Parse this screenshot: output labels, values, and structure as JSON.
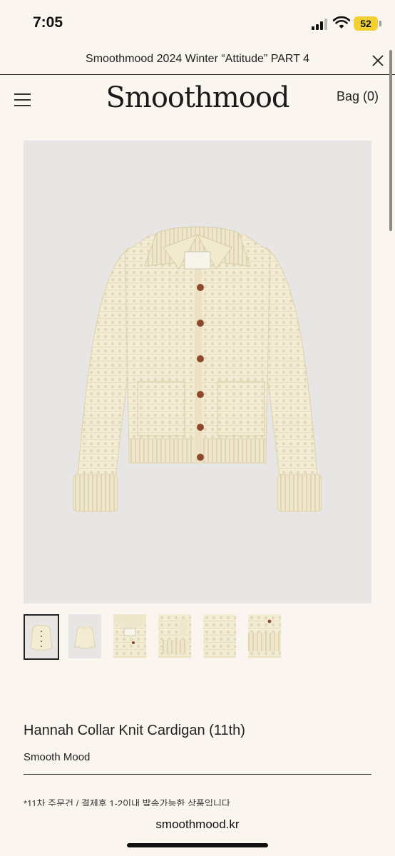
{
  "status_bar": {
    "time": "7:05",
    "battery": "52",
    "icons": [
      "signal-icon",
      "wifi-icon",
      "battery-icon"
    ]
  },
  "banner": {
    "text": "Smoothmood 2024 Winter “Attitude” PART 4",
    "close_icon": "close-icon"
  },
  "header": {
    "menu_icon": "hamburger-menu-icon",
    "logo": "Smoothmood",
    "bag_label": "Bag (0)"
  },
  "gallery": {
    "thumbnails_count": 6,
    "active_index": 0,
    "colors": {
      "background": "#e7e6e4",
      "knit": "#f3ecd4",
      "button": "#8b4a2b"
    }
  },
  "product": {
    "title": "Hannah Collar Knit Cardigan (11th)",
    "brand": "Smooth Mood",
    "note": "*11차 주문건 / 결제후 1-2이내 발송가능한 상품입니다"
  },
  "browser": {
    "url": "smoothmood.kr"
  }
}
